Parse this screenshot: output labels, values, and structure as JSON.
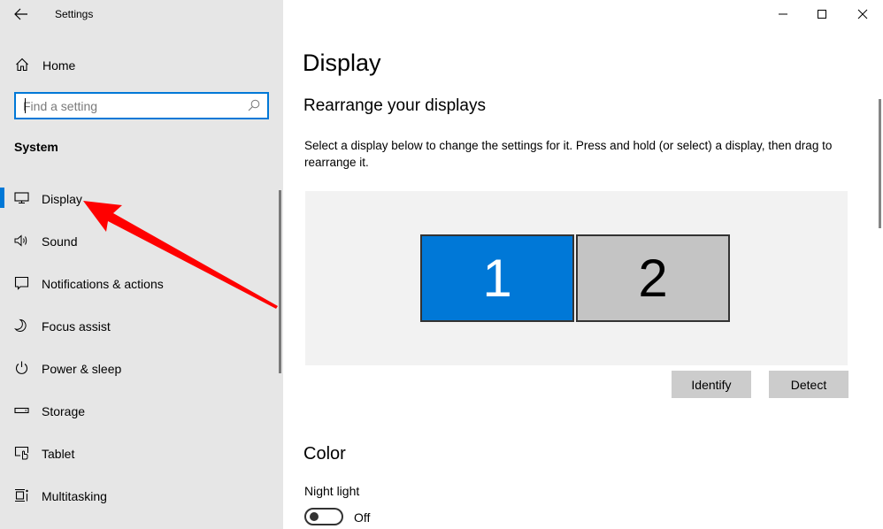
{
  "window": {
    "title": "Settings",
    "controls": {
      "minimize": "minimize",
      "maximize": "maximize",
      "close": "close"
    }
  },
  "sidebar": {
    "back_icon": "back-arrow-icon",
    "home": {
      "label": "Home",
      "icon": "home-icon"
    },
    "search": {
      "placeholder": "Find a setting",
      "value": "",
      "icon": "search-icon"
    },
    "section": "System",
    "items": [
      {
        "label": "Display",
        "icon": "monitor-icon",
        "selected": true
      },
      {
        "label": "Sound",
        "icon": "speaker-icon",
        "selected": false
      },
      {
        "label": "Notifications & actions",
        "icon": "notification-icon",
        "selected": false
      },
      {
        "label": "Focus assist",
        "icon": "moon-icon",
        "selected": false
      },
      {
        "label": "Power & sleep",
        "icon": "power-icon",
        "selected": false
      },
      {
        "label": "Storage",
        "icon": "storage-icon",
        "selected": false
      },
      {
        "label": "Tablet",
        "icon": "tablet-icon",
        "selected": false
      },
      {
        "label": "Multitasking",
        "icon": "multitasking-icon",
        "selected": false
      }
    ],
    "accent_color": "#0078d7"
  },
  "main": {
    "title": "Display",
    "rearrange": {
      "heading": "Rearrange your displays",
      "description": "Select a display below to change the settings for it. Press and hold (or select) a display, then drag to rearrange it.",
      "displays": [
        {
          "number": "1",
          "selected": true,
          "color": "#0078d7"
        },
        {
          "number": "2",
          "selected": false,
          "color": "#c4c4c4"
        }
      ],
      "identify_label": "Identify",
      "detect_label": "Detect"
    },
    "color": {
      "heading": "Color",
      "night_light_label": "Night light",
      "night_light_on": false,
      "night_light_state": "Off"
    }
  },
  "annotation": {
    "type": "arrow",
    "color": "#ff0000",
    "points_to": "Display"
  }
}
